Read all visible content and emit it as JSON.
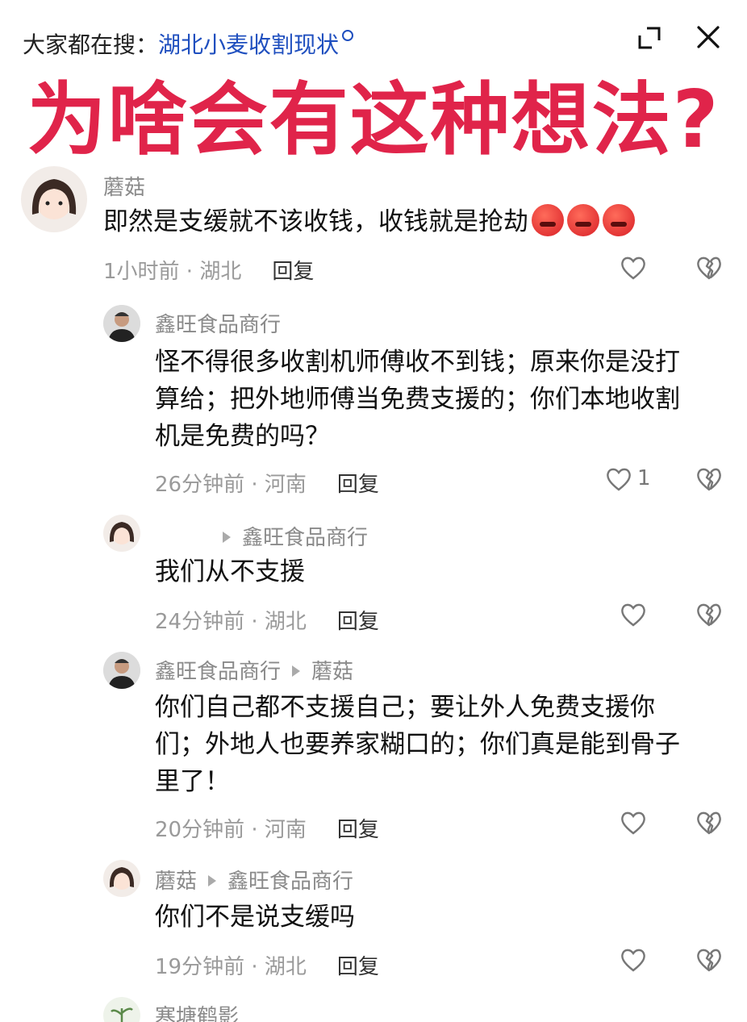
{
  "search_hint": {
    "prefix": "大家都在搜：",
    "keyword": "湖北小麦收割现状"
  },
  "headline": "为啥会有这种想法?",
  "comments": [
    {
      "username": "蘑菇",
      "reply_to": "",
      "text": "即然是支缓就不该收钱，收钱就是抢劫",
      "time_loc": "1小时前 · 湖北",
      "reply_label": "回复",
      "likes": ""
    },
    {
      "username": "鑫旺食品商行",
      "reply_to": "",
      "text": "怪不得很多收割机师傅收不到钱；原来你是没打算给；把外地师傅当免费支援的；你们本地收割机是免费的吗？",
      "time_loc": "26分钟前 · 河南",
      "reply_label": "回复",
      "likes": "1"
    },
    {
      "username": "",
      "reply_to": "鑫旺食品商行",
      "text": "我们从不支援",
      "time_loc": "24分钟前 · 湖北",
      "reply_label": "回复",
      "likes": ""
    },
    {
      "username": "鑫旺食品商行",
      "reply_to": "蘑菇",
      "text": "你们自己都不支援自己；要让外人免费支援你们；外地人也要养家糊口的；你们真是能到骨子里了！",
      "time_loc": "20分钟前 · 河南",
      "reply_label": "回复",
      "likes": ""
    },
    {
      "username": "蘑菇",
      "reply_to": "鑫旺食品商行",
      "text": "你们不是说支缓吗",
      "time_loc": "19分钟前 · 湖北",
      "reply_label": "回复",
      "likes": ""
    },
    {
      "username": "寒塘鹤影",
      "reply_to": "",
      "text": "",
      "time_loc": "",
      "reply_label": "",
      "likes": ""
    }
  ],
  "icons": {
    "expand": "expand-icon",
    "close": "close-icon",
    "like": "heart-icon",
    "dislike": "broken-heart-icon",
    "angry_emoji": "angry-face-emoji"
  },
  "colors": {
    "headline": "#e0244a",
    "keyword": "#1f4fbf",
    "meta": "#9a9a9a"
  }
}
